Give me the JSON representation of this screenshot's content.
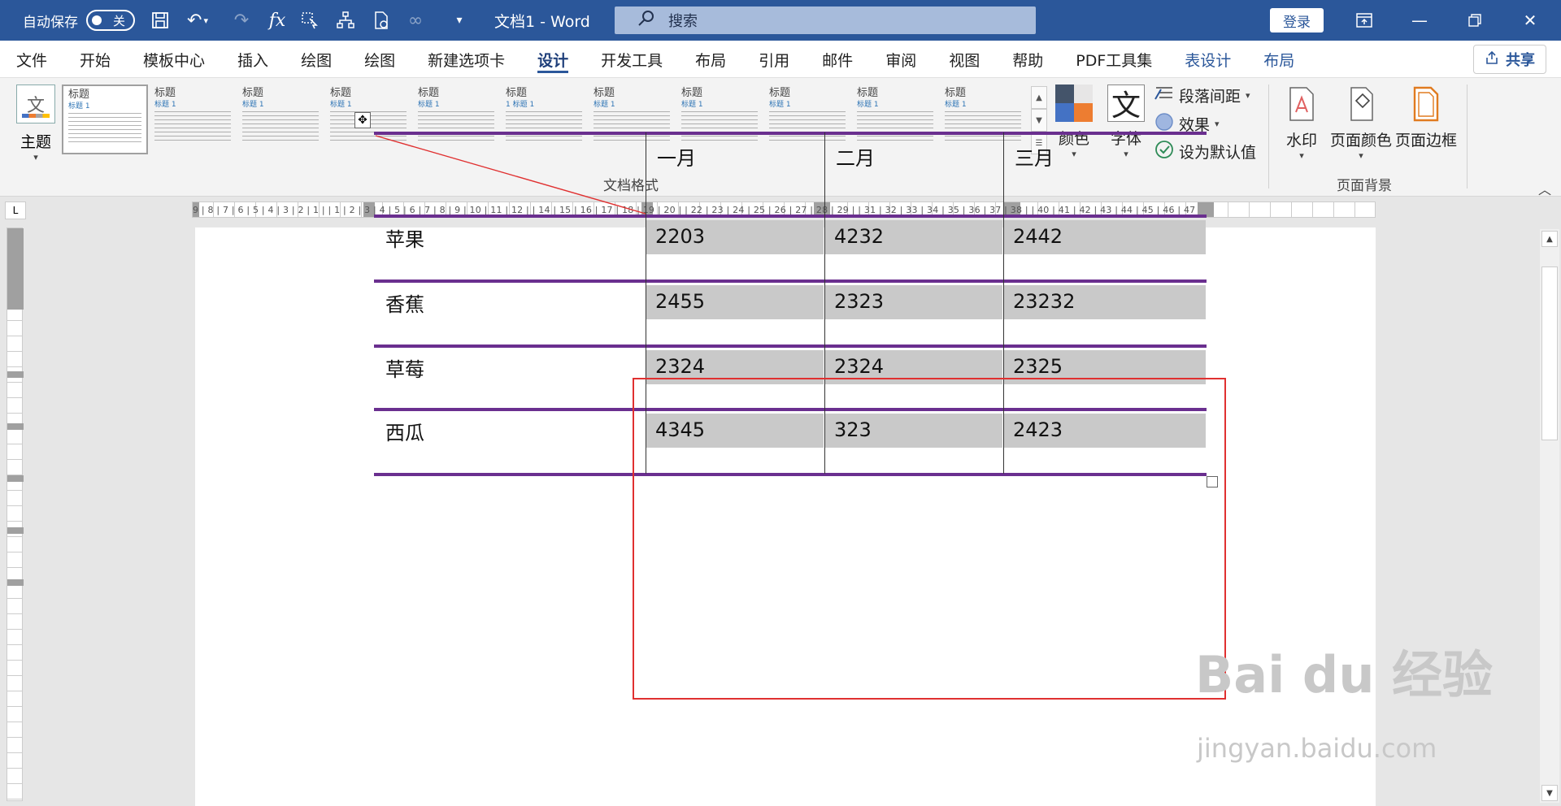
{
  "titlebar": {
    "autosave_label": "自动保存",
    "autosave_state": "关",
    "doc_title": "文档1 - Word",
    "search_placeholder": "搜索",
    "login_label": "登录",
    "accent_color": "#2b579a"
  },
  "menu": {
    "items": [
      "文件",
      "开始",
      "模板中心",
      "插入",
      "绘图",
      "绘图",
      "新建选项卡",
      "设计",
      "开发工具",
      "布局",
      "引用",
      "邮件",
      "审阅",
      "视图",
      "帮助",
      "PDF工具集",
      "表设计",
      "布局"
    ],
    "active": "设计",
    "share_label": "共享"
  },
  "ribbon": {
    "theme_label": "主题",
    "styles": [
      {
        "title": "标题",
        "sub": "标题 1"
      },
      {
        "title": "标题",
        "sub": "标题 1"
      },
      {
        "title": "标题",
        "sub": "标题 1"
      },
      {
        "title": "标题",
        "sub": "标题 1"
      },
      {
        "title": "标题",
        "sub": "标题 1"
      },
      {
        "title": "标题",
        "sub": "1  标题 1"
      },
      {
        "title": "标题",
        "sub": "标题 1"
      },
      {
        "title": "标题",
        "sub": "标题 1"
      },
      {
        "title": "标题",
        "sub": "标题 1"
      },
      {
        "title": "标题",
        "sub": "标题 1"
      },
      {
        "title": "标题",
        "sub": "标题 1"
      }
    ],
    "doc_format_label": "文档格式",
    "colors_label": "颜色",
    "font_label": "字体",
    "font_glyph": "文",
    "paragraph_spacing_label": "段落间距",
    "effects_label": "效果",
    "set_default_label": "设为默认值",
    "watermark_label": "水印",
    "page_color_label": "页面颜色",
    "page_border_label": "页面边框",
    "page_bg_label": "页面背景"
  },
  "ruler": {
    "h_numbers": "9 | 8 | 7 | 6 | 5 | 4 | 3 | 2 | 1 |    | 1 | 2 | 3 | 4 | 5 | 6 | 7 | 8 | 9 | 10 | 11 | 12 |    | 14 | 15 | 16 | 17 | 18 | 19 | 20 |    | 22 | 23 | 24 | 25 | 26 | 27 | 28 | 29 |    | 31 | 32 | 33 | 34 | 35 | 36 | 37 | 38 |    | 40 | 41 | 42 | 43 | 44 | 45 | 46 | 47"
  },
  "table": {
    "headers": [
      "",
      "一月",
      "二月",
      "三月"
    ],
    "rows": [
      {
        "label": "苹果",
        "values": [
          "2203",
          "4232",
          "2442"
        ]
      },
      {
        "label": "香蕉",
        "values": [
          "2455",
          "2323",
          "23232"
        ]
      },
      {
        "label": "草莓",
        "values": [
          "2324",
          "2324",
          "2325"
        ]
      },
      {
        "label": "西瓜",
        "values": [
          "4345",
          "323",
          "2423"
        ]
      }
    ],
    "border_color": "#6a2f8f",
    "shade_color": "#c9c9c9"
  },
  "overlay": {
    "selection_color": "#e03030",
    "watermark_main": "Bai du 经验",
    "watermark_sub": "jingyan.baidu.com"
  }
}
